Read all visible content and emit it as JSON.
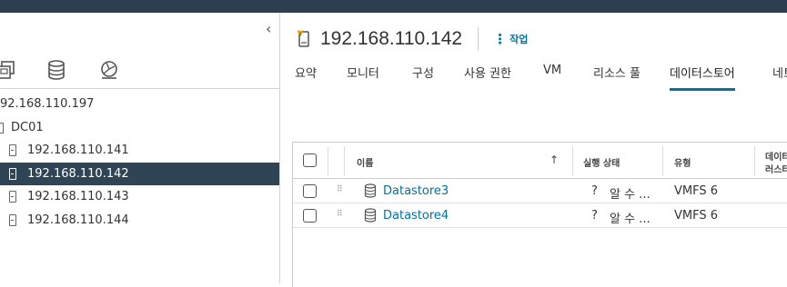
{
  "colors": {
    "topbar": "#2c3e50",
    "selected_row": "#2f4454",
    "link": "#0072a3"
  },
  "nav": {
    "collapse_glyph": "‹",
    "icons": [
      "vms-and-templates-icon",
      "storage-icon",
      "networking-icon"
    ],
    "tree": [
      {
        "label": "92.168.110.197",
        "type": "vcenter"
      },
      {
        "label": "DC01",
        "type": "datacenter"
      },
      {
        "label": "192.168.110.141",
        "type": "host"
      },
      {
        "label": "192.168.110.142",
        "type": "host",
        "selected": true
      },
      {
        "label": "192.168.110.143",
        "type": "host"
      },
      {
        "label": "192.168.110.144",
        "type": "host"
      }
    ]
  },
  "main": {
    "title": "192.168.110.142",
    "title_icon": "host-warning-icon",
    "actions_label": "작업",
    "tabs": [
      "요약",
      "모니터",
      "구성",
      "사용 권한",
      "VM",
      "리소스 풀",
      "데이터스토어",
      "네트"
    ],
    "active_tab": "데이터스토어"
  },
  "grid": {
    "columns": [
      "이름",
      "실행 상태",
      "유형",
      "데이터",
      "러스터"
    ],
    "sort_indicator": "↑",
    "rows": [
      {
        "name": "Datastore3",
        "state_symbol": "?",
        "state_text": "알 수 ...",
        "type": "VMFS 6"
      },
      {
        "name": "Datastore4",
        "state_symbol": "?",
        "state_text": "알 수 ...",
        "type": "VMFS 6"
      }
    ]
  }
}
